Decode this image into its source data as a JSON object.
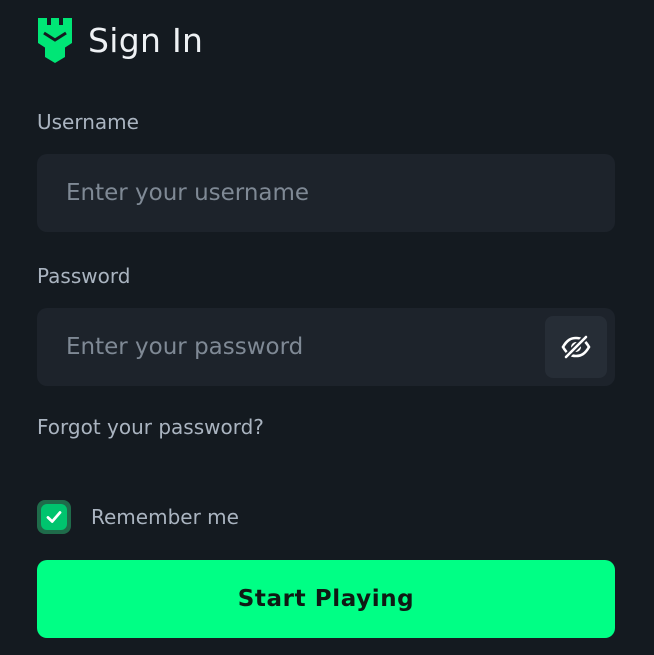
{
  "header": {
    "title": "Sign In",
    "logo_icon": "castle-tower-icon",
    "logo_color": "#00e676"
  },
  "form": {
    "username": {
      "label": "Username",
      "placeholder": "Enter your username",
      "value": ""
    },
    "password": {
      "label": "Password",
      "placeholder": "Enter your password",
      "value": "",
      "toggle_icon": "eye-off-icon"
    },
    "forgot_password": "Forgot your password?",
    "remember_me": {
      "label": "Remember me",
      "checked": true,
      "check_color": "#00c46e"
    },
    "submit_label": "Start Playing"
  },
  "colors": {
    "background": "#141a20",
    "field_background": "#1d232b",
    "accent": "#00ff85",
    "label_text": "#aab4c0",
    "placeholder_text": "#7f8995"
  }
}
